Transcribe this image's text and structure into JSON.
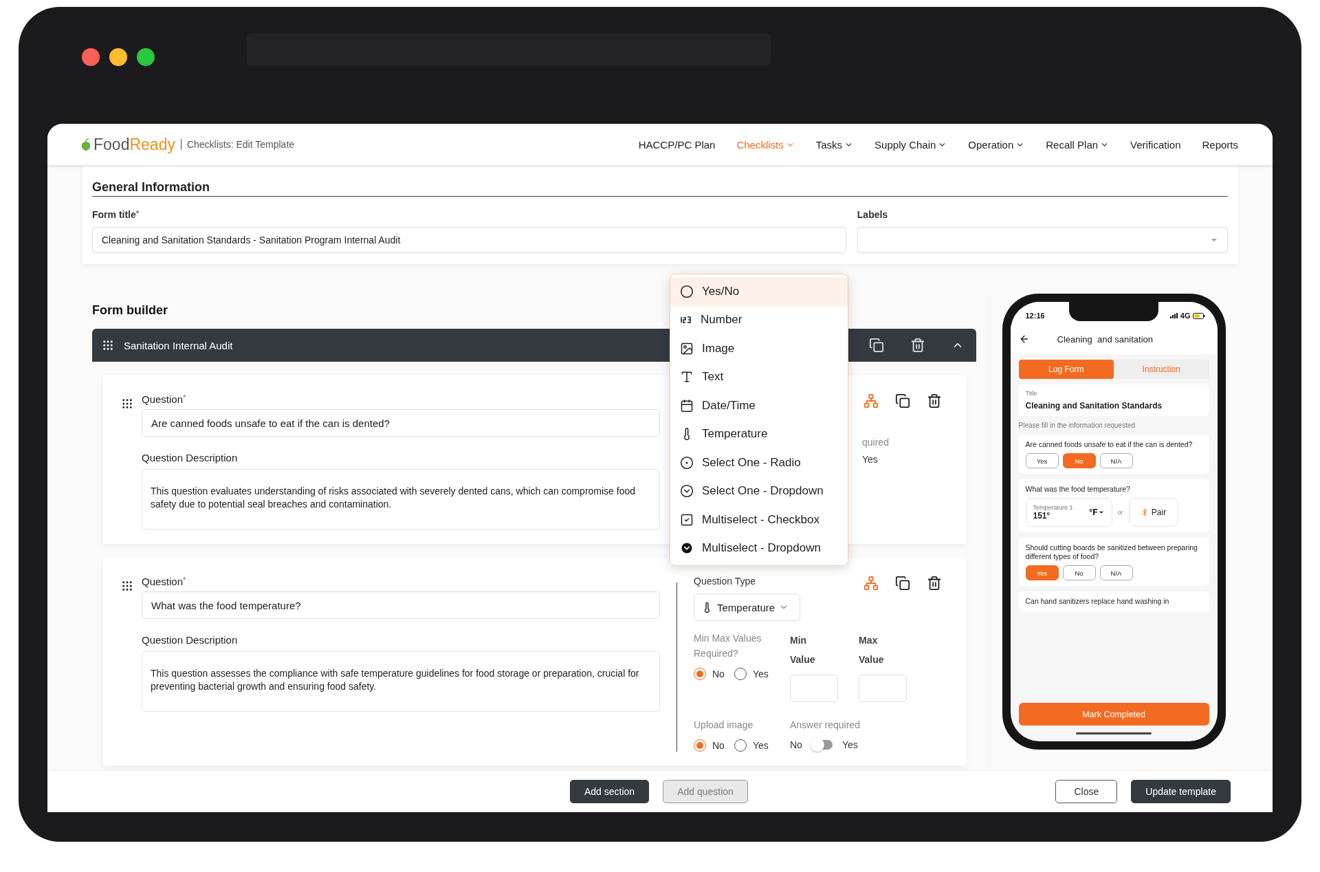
{
  "app": {
    "logo": [
      "Food",
      "Ready"
    ],
    "page_title": "Checklists: Edit Template",
    "nav": [
      {
        "label": "HACCP/PC Plan",
        "selected": false,
        "has_menu": false
      },
      {
        "label": "Checklists",
        "selected": true,
        "has_menu": true
      },
      {
        "label": "Tasks",
        "selected": false,
        "has_menu": true
      },
      {
        "label": "Supply Chain",
        "selected": false,
        "has_menu": true
      },
      {
        "label": "Operation",
        "selected": false,
        "has_menu": true
      },
      {
        "label": "Recall Plan",
        "selected": false,
        "has_menu": true
      },
      {
        "label": "Verification",
        "selected": false,
        "has_menu": false
      },
      {
        "label": "Reports",
        "selected": false,
        "has_menu": false
      }
    ]
  },
  "general_info": {
    "title": "General Information",
    "form_title": {
      "label": "Form title",
      "required_mark": "*",
      "value": "Cleaning and Sanitation Standards - Sanitation Program Internal Audit"
    },
    "labels": {
      "label": "Labels"
    }
  },
  "form_builder": {
    "title": "Form builder",
    "section": {
      "title": "Sanitation Internal Audit",
      "expanded": true
    },
    "questions": [
      {
        "label": "Question",
        "required_mark": "*",
        "value": "Are canned foods unsafe to eat if the can is dented?",
        "description_label": "Question Description",
        "description": "This question evaluates understanding of risks associated with severely dented cans, which can compromise food safety due to potential seal breaches and contamination.",
        "kind": "partial",
        "answer_required_label": "quired",
        "answer_required_option": "Yes"
      },
      {
        "label": "Question",
        "required_mark": "*",
        "value": "What was the food temperature?",
        "description_label": "Question Description",
        "description": "This question assesses the compliance with safe temperature guidelines for food storage or preparation, crucial for preventing bacterial growth and ensuring food safety.",
        "kind": "full",
        "type_label": "Question Type",
        "type_value": "Temperature",
        "min_max": {
          "label": "Min Max Values Required?",
          "options": [
            {
              "label": "No",
              "selected": true
            },
            {
              "label": "Yes",
              "selected": false
            }
          ]
        },
        "min_label": "Min Value",
        "max_label": "Max Value",
        "upload_image": {
          "label": "Upload image",
          "options": [
            {
              "label": "No",
              "selected": true
            },
            {
              "label": "Yes",
              "selected": false
            }
          ]
        },
        "answer_required": {
          "label": "Answer required",
          "off_label": "No",
          "on_label": "Yes",
          "on": false
        }
      }
    ],
    "type_menu": {
      "items": [
        {
          "label": "Yes/No",
          "highlighted": true
        },
        {
          "label": "Number",
          "highlighted": false
        },
        {
          "label": "Image",
          "highlighted": false
        },
        {
          "label": "Text",
          "highlighted": false
        },
        {
          "label": "Date/Time",
          "highlighted": false
        },
        {
          "label": "Temperature",
          "highlighted": false
        },
        {
          "label": "Select One - Radio",
          "highlighted": false
        },
        {
          "label": "Select One - Dropdown",
          "highlighted": false
        },
        {
          "label": "Multiselect - Checkbox",
          "highlighted": false
        },
        {
          "label": "Multiselect - Dropdown",
          "highlighted": false
        }
      ]
    }
  },
  "phone": {
    "time": "12:16",
    "network": "4G",
    "title": "Cleaning  and sanitation",
    "tabs": [
      {
        "label": "Log Form",
        "selected": true
      },
      {
        "label": "Instruction",
        "selected": false
      }
    ],
    "title_field": {
      "label": "Title",
      "value": "Cleaning and Sanitation Standards"
    },
    "hint": "Please fill in the information requested",
    "questions": [
      {
        "kind": "choice",
        "text": "Are canned foods unsafe to eat if the can is dented?",
        "options": [
          {
            "label": "Yes",
            "selected": false
          },
          {
            "label": "No",
            "selected": true
          },
          {
            "label": "N/A",
            "selected": false
          }
        ]
      },
      {
        "kind": "temperature",
        "text": "What was the food temperature?",
        "field_label": "Temperature 1",
        "value": "151°",
        "unit": "°F",
        "or": "or",
        "pair": "Pair"
      },
      {
        "kind": "choice",
        "text": "Should cutting boards be sanitized between preparing different types of food?",
        "options": [
          {
            "label": "Yes",
            "selected": true
          },
          {
            "label": "No",
            "selected": false
          },
          {
            "label": "N/A",
            "selected": false
          }
        ]
      },
      {
        "kind": "text",
        "text": "Can hand sanitizers replace hand washing in"
      }
    ],
    "button": "Mark Completed"
  },
  "footer": {
    "buttons": [
      {
        "label": "Add section",
        "kind": "dark",
        "disabled": false
      },
      {
        "label": "Add question",
        "kind": "dark",
        "disabled": true
      }
    ],
    "right_buttons": [
      {
        "label": "Close",
        "kind": "outline",
        "disabled": false
      },
      {
        "label": "Update template",
        "kind": "dark",
        "disabled": false
      }
    ]
  }
}
